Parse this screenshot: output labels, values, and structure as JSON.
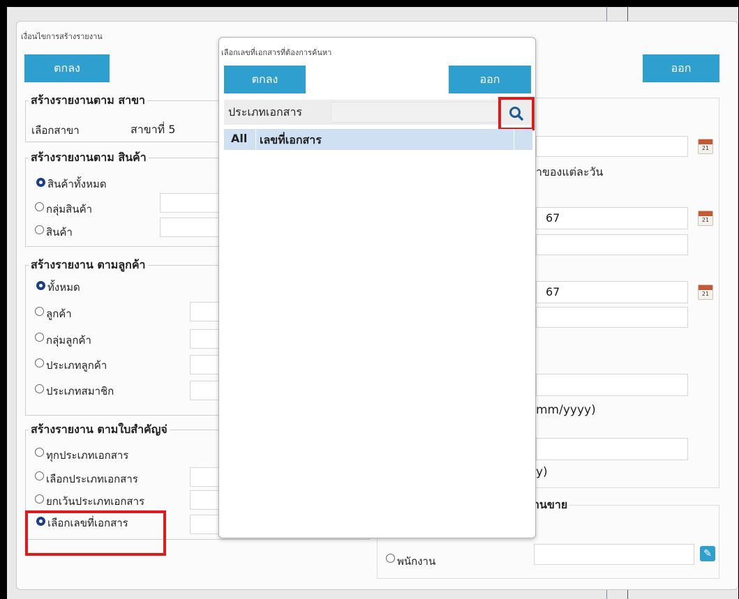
{
  "main": {
    "title": "เงื่อนไขการสร้างรายงาน",
    "ok_label": "ตกลง",
    "exit_label": "ออก",
    "branch_group": {
      "legend": "สร้างรายงานตาม สาขา",
      "label": "เลือกสาขา",
      "value": "สาขาที่ 5"
    },
    "product_group": {
      "legend": "สร้างรายงานตาม สินค้า",
      "options": [
        "สินค้าทั้งหมด",
        "กลุ่มสินค้า",
        "สินค้า"
      ],
      "selected": "สินค้าทั้งหมด"
    },
    "customer_group": {
      "legend": "สร้างรายงาน ตามลูกค้า",
      "options": [
        "ทั้งหมด",
        "ลูกค้า",
        "กลุ่มลูกค้า",
        "ประเภทลูกค้า",
        "ประเภทสมาชิก"
      ],
      "selected": "ทั้งหมด"
    },
    "document_group": {
      "legend": "สร้างรายงาน ตามใบสำคัญจ่",
      "options": [
        "ทุกประเภทเอกสาร",
        "เลือกประเภทเอกสาร",
        "ยกเว้นประเภทเอกสาร",
        "เลือกเลขที่เอกสาร"
      ],
      "selected": "เลือกเลขที่เอกสาร"
    },
    "right_panel": {
      "date_note": "าของแต่ละวัน",
      "date_from_value": "67",
      "date_to_value": "67",
      "format_hint_1": "mm/yyyy)",
      "format_hint_2": "y)",
      "calendar_label": "21",
      "salesperson_legend": "านขาย",
      "salesperson_option": "พนักงาน"
    }
  },
  "dialog": {
    "title": "เลือกเลขที่เอกสารที่ต้องการค้นหา",
    "ok_label": "ตกลง",
    "exit_label": "ออก",
    "doc_type_label": "ประเภทเอกสาร",
    "doc_type_value": "",
    "table_headers": [
      "All",
      "เลขที่เอกสาร"
    ]
  },
  "colors": {
    "accent": "#2f9fd0",
    "highlight": "#e01b1b",
    "header_row": "#cfe0f3"
  },
  "icons": [
    "search-icon",
    "calendar-icon",
    "edit-icon"
  ]
}
